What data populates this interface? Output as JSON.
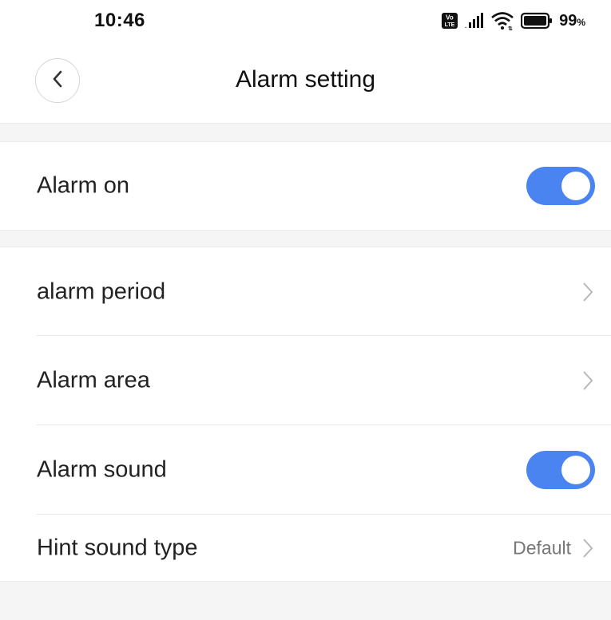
{
  "status_bar": {
    "time": "10:46",
    "battery_percent": "99",
    "battery_percent_sign": "%",
    "icons": [
      "volte-icon",
      "signal-icon",
      "wifi-icon",
      "battery-icon"
    ]
  },
  "header": {
    "title": "Alarm setting",
    "back_icon": "chevron-left-icon"
  },
  "settings": {
    "alarm_on": {
      "label": "Alarm on",
      "toggle_on": true
    },
    "alarm_period": {
      "label": "alarm period"
    },
    "alarm_area": {
      "label": "Alarm area"
    },
    "alarm_sound": {
      "label": "Alarm sound",
      "toggle_on": true
    },
    "hint_sound_type": {
      "label": "Hint sound type",
      "value": "Default"
    }
  },
  "colors": {
    "toggle_on": "#4a84f1",
    "section_gap": "#f5f5f5",
    "divider": "#e8e8e8",
    "chevron": "#b8b8b8"
  }
}
